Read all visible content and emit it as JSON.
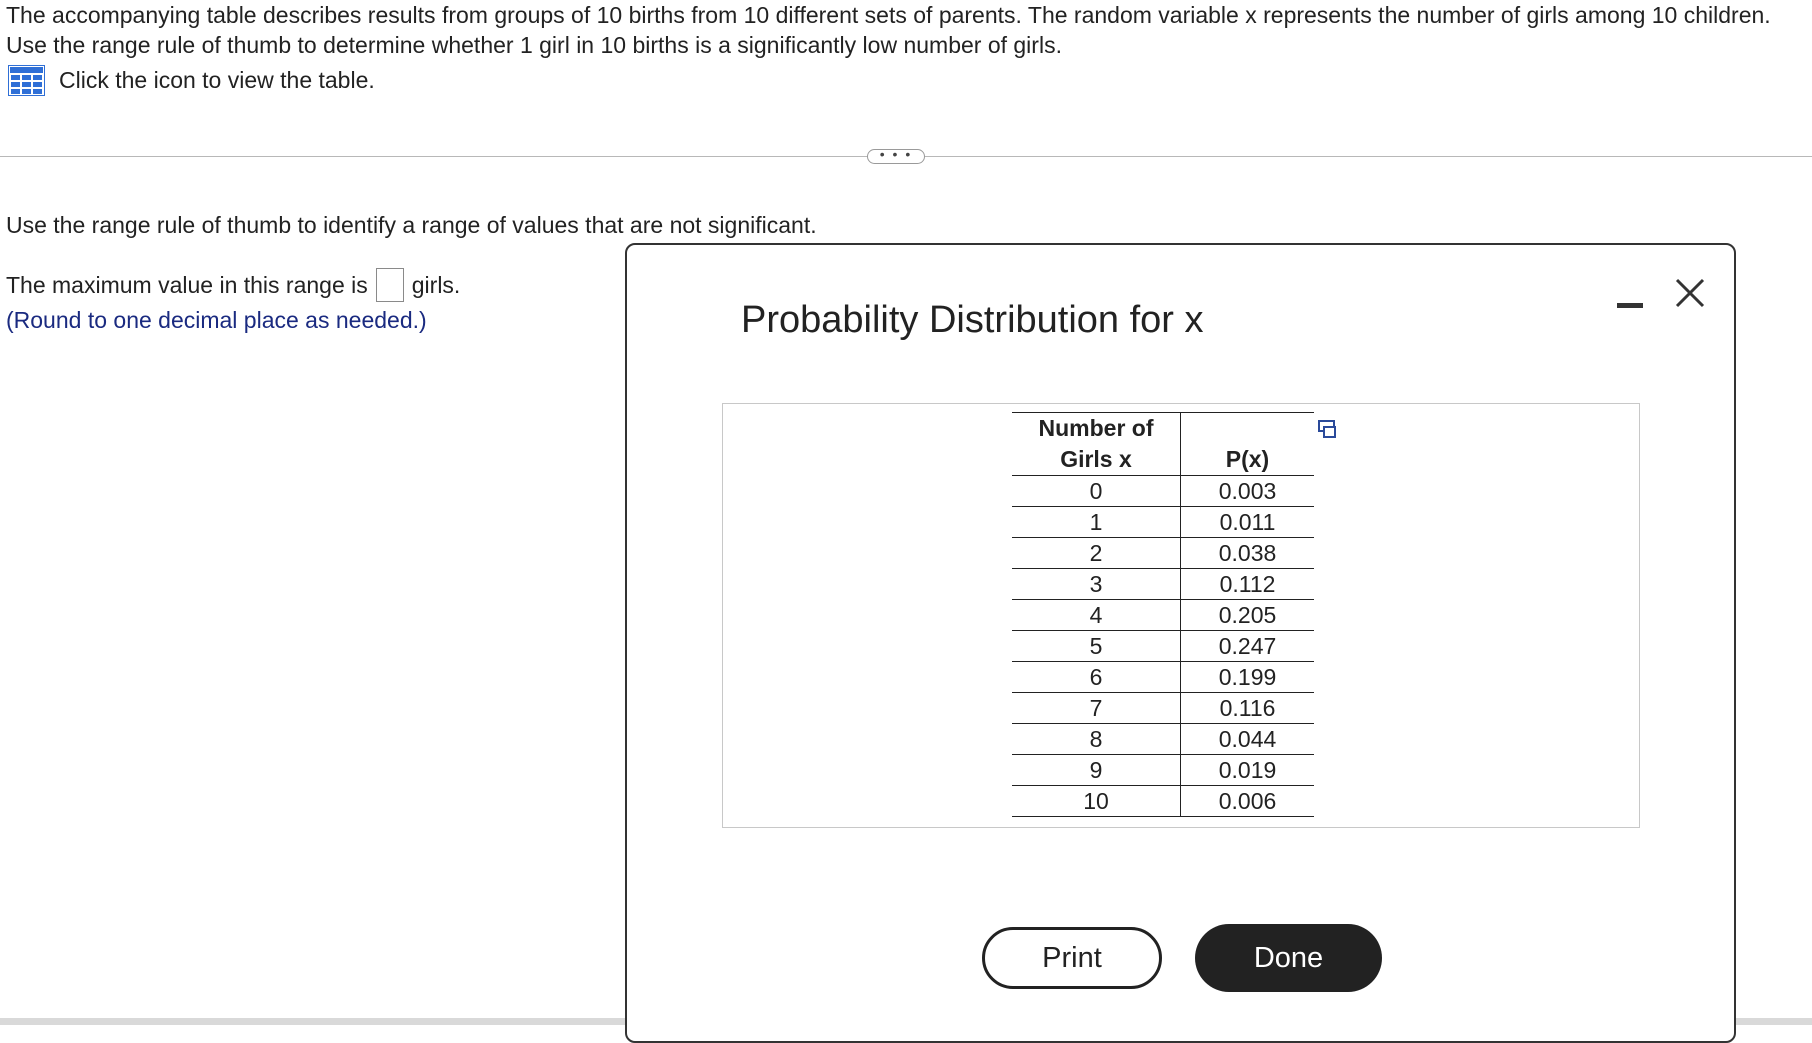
{
  "question": {
    "text": "The accompanying table describes results from groups of 10 births from 10 different sets of parents. The random variable x represents the number of girls among 10 children. Use the range rule of thumb to determine whether 1 girl in 10 births is a significantly low number of girls.",
    "table_link_label": "Click the icon to view the table.",
    "table_icon": "table-grid-icon"
  },
  "more_button": {
    "label": "• • •"
  },
  "subquestion": {
    "instruction": "Use the range rule of thumb to identify a range of values that are not significant.",
    "answer_prefix": "The maximum value in this range is",
    "answer_value": "",
    "answer_suffix": "girls.",
    "hint": "(Round to one decimal place as needed.)"
  },
  "modal": {
    "title": "Probability Distribution for x",
    "minimize_icon": "minimize-icon",
    "close_icon": "close-icon",
    "copy_icon": "copy-icon",
    "table": {
      "header_x_line1": "Number of",
      "header_x_line2": "Girls x",
      "header_p": "P(x)",
      "rows": [
        {
          "x": "0",
          "p": "0.003"
        },
        {
          "x": "1",
          "p": "0.011"
        },
        {
          "x": "2",
          "p": "0.038"
        },
        {
          "x": "3",
          "p": "0.112"
        },
        {
          "x": "4",
          "p": "0.205"
        },
        {
          "x": "5",
          "p": "0.247"
        },
        {
          "x": "6",
          "p": "0.199"
        },
        {
          "x": "7",
          "p": "0.116"
        },
        {
          "x": "8",
          "p": "0.044"
        },
        {
          "x": "9",
          "p": "0.019"
        },
        {
          "x": "10",
          "p": "0.006"
        }
      ]
    },
    "print_label": "Print",
    "done_label": "Done"
  },
  "colors": {
    "hint_text": "#1a2a80",
    "icon_blue": "#2f6fd6",
    "done_bg": "#222222"
  }
}
